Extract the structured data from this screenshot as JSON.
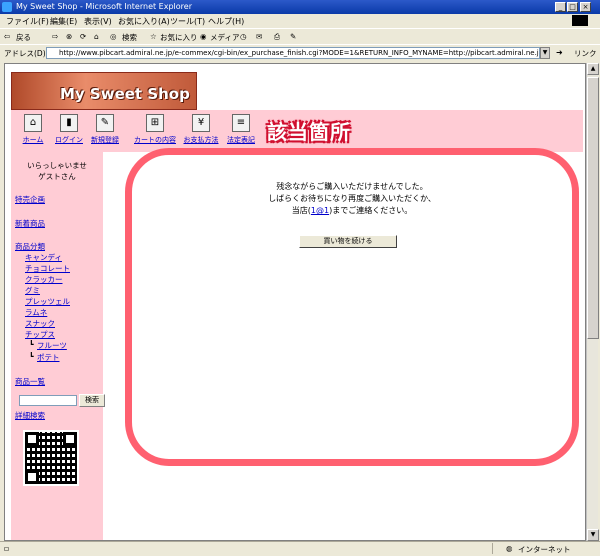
{
  "window": {
    "title": "My Sweet Shop - Microsoft Internet Explorer",
    "buttons": [
      "_",
      "□",
      "×"
    ]
  },
  "menu": [
    "ファイル(F)",
    "編集(E)",
    "表示(V)",
    "お気に入り(A)",
    "ツール(T)",
    "ヘルプ(H)"
  ],
  "toolbar": {
    "back": "戻る",
    "search": "検索",
    "favorites": "お気に入り",
    "media": "メディア"
  },
  "address": {
    "label": "アドレス(D)",
    "url": "http://www.pibcart.admiral.ne.jp/e-commex/cgi-bin/ex_purchase_finish.cgi?MODE=1&RETURN_INFO_MYNAME=http://pibcart.admiral.ne.jp/e-commex/",
    "links": "リンク"
  },
  "shop": {
    "logo": "My Sweet Shop",
    "nav": [
      {
        "label": "ホーム",
        "icon": "house-icon",
        "glyph": "⌂"
      },
      {
        "label": "ログイン",
        "icon": "door-icon",
        "glyph": "▮"
      },
      {
        "label": "新規登録",
        "icon": "pen-icon",
        "glyph": "✎"
      },
      {
        "label": "カートの内容",
        "icon": "cart-icon",
        "glyph": "⊞"
      },
      {
        "label": "お支払方法",
        "icon": "yen-icon",
        "glyph": "¥"
      },
      {
        "label": "法定表記",
        "icon": "document-icon",
        "glyph": "≡"
      }
    ],
    "overlay_label": "該当箇所"
  },
  "sidebar": {
    "greeting_line1": "いらっしゃいませ",
    "greeting_line2": "ゲストさん",
    "feature": "特売企画",
    "new": "新着商品",
    "category_title": "商品分類",
    "categories": [
      "キャンディ",
      "チョコレート",
      "クラッカー",
      "グミ",
      "プレッツェル",
      "ラムネ",
      "スナック",
      "チップス"
    ],
    "subcategories": [
      "フルーツ",
      "ポテト"
    ],
    "subcategory_prefix": "┗",
    "product_list": "商品一覧",
    "search_button": "検索",
    "advanced_search": "詳細検索"
  },
  "main": {
    "line1": "残念ながらご購入いただけませんでした。",
    "line2": "しばらくお待ちになり再度ご購入いただくか、",
    "line3_pre": "当店(",
    "line3_link": "1@1",
    "line3_post": ")までご連絡ください。",
    "continue_button": "買い物を続ける"
  },
  "status": {
    "zone": "インターネット"
  }
}
